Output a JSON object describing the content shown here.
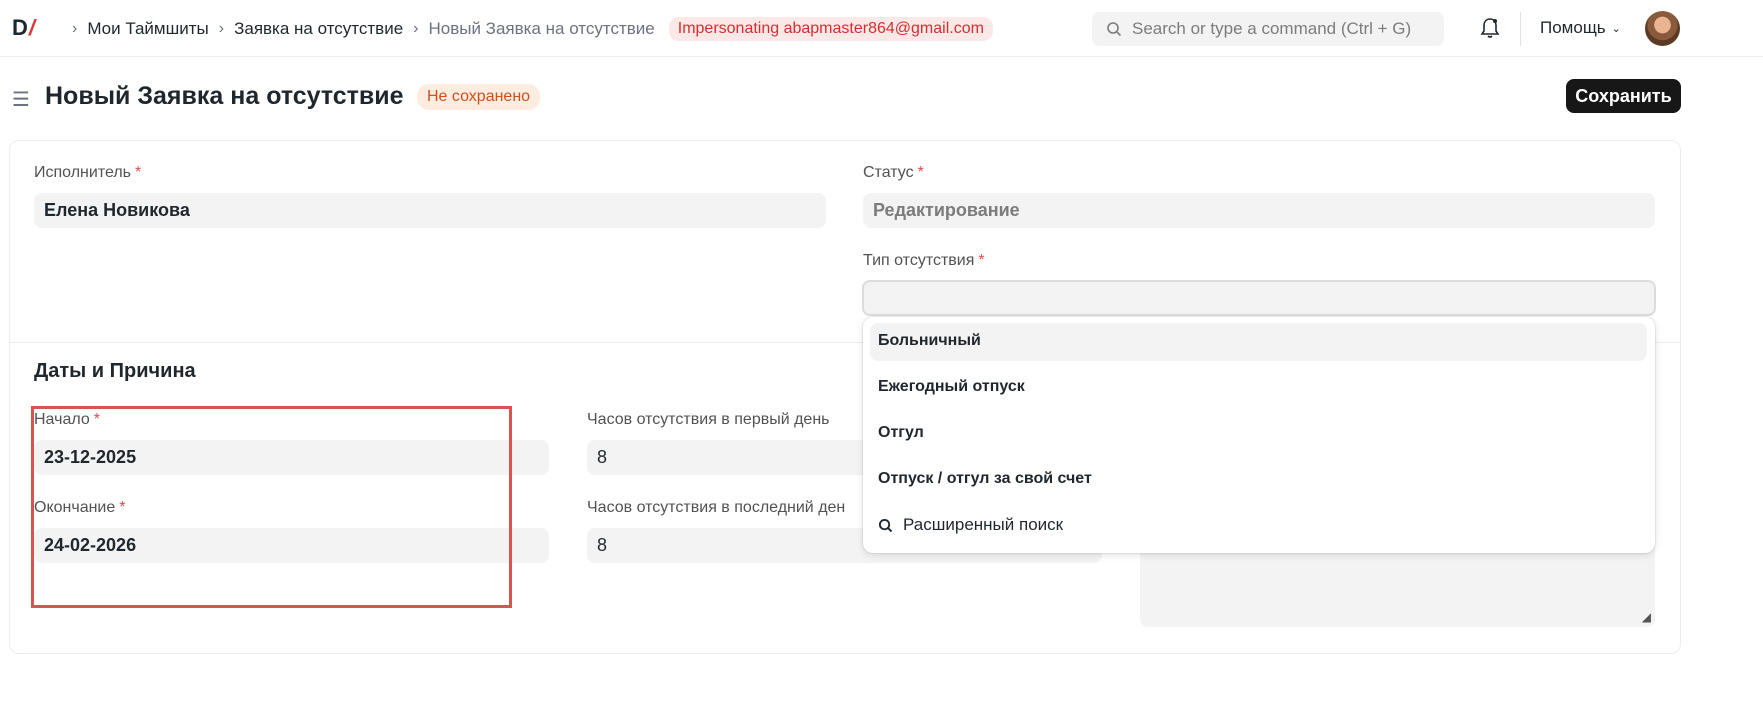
{
  "navbar": {
    "logo_text": "D",
    "logo_slash": "/",
    "breadcrumbs": [
      "Мои Таймшиты",
      "Заявка на отсутствие",
      "Новый Заявка на отсутствие"
    ],
    "impersonating": "Impersonating abapmaster864@gmail.com",
    "search_placeholder": "Search or type a command (Ctrl + G)",
    "help_label": "Помощь"
  },
  "page": {
    "title": "Новый Заявка на отсутствие",
    "status_badge": "Не сохранено",
    "save_label": "Сохранить"
  },
  "form": {
    "executor_label": "Исполнитель",
    "executor_value": "Елена Новикова",
    "status_label": "Статус",
    "status_value": "Редактирование",
    "absence_type_label": "Тип отсутствия",
    "absence_type_value": "",
    "section_title": "Даты и Причина",
    "start_label": "Начало",
    "start_value": "23-12-2025",
    "end_label": "Окончание",
    "end_value": "24-02-2026",
    "first_day_hours_label": "Часов отсутствия в первый день",
    "first_day_hours_value": "8",
    "last_day_hours_label": "Часов отсутствия в последний ден",
    "last_day_hours_value": "8",
    "required_mark": "*"
  },
  "dropdown": {
    "options": [
      "Больничный",
      "Ежегодный отпуск",
      "Отгул",
      "Отпуск / отгул за свой счет"
    ],
    "advanced_search": "Расширенный поиск"
  },
  "colors": {
    "accent_red": "#e24c4c",
    "highlight": "#d9534f",
    "save_button": "#171717"
  }
}
